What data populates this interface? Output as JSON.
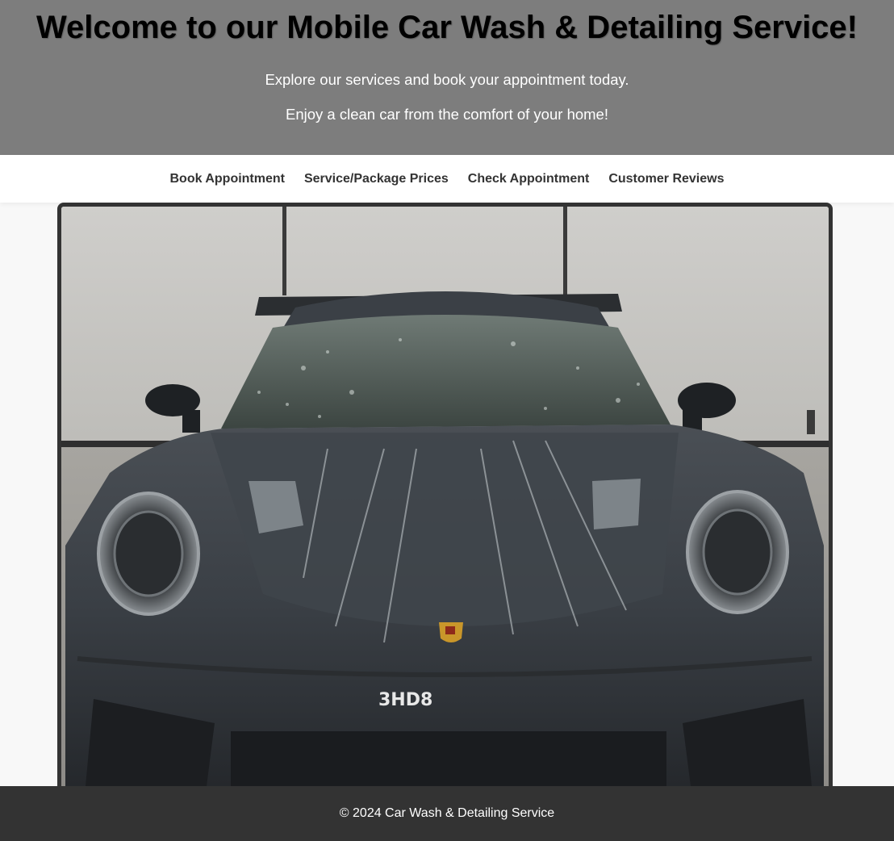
{
  "header": {
    "title": "Welcome to our Mobile Car Wash & Detailing Service!",
    "line1": "Explore our services and book your appointment today.",
    "line2": "Enjoy a clean car from the comfort of your home!"
  },
  "nav": {
    "items": [
      {
        "label": "Book Appointment"
      },
      {
        "label": "Service/Package Prices"
      },
      {
        "label": "Check Appointment"
      },
      {
        "label": "Customer Reviews"
      }
    ]
  },
  "hero": {
    "alt": "Wet sports car being washed in a garage",
    "plate_text": "3HD8"
  },
  "footer": {
    "text": "© 2024 Car Wash & Detailing Service"
  },
  "colors": {
    "header_bg": "#7d7d7d",
    "nav_bg": "#ffffff",
    "footer_bg": "#333333",
    "frame": "#333333"
  }
}
